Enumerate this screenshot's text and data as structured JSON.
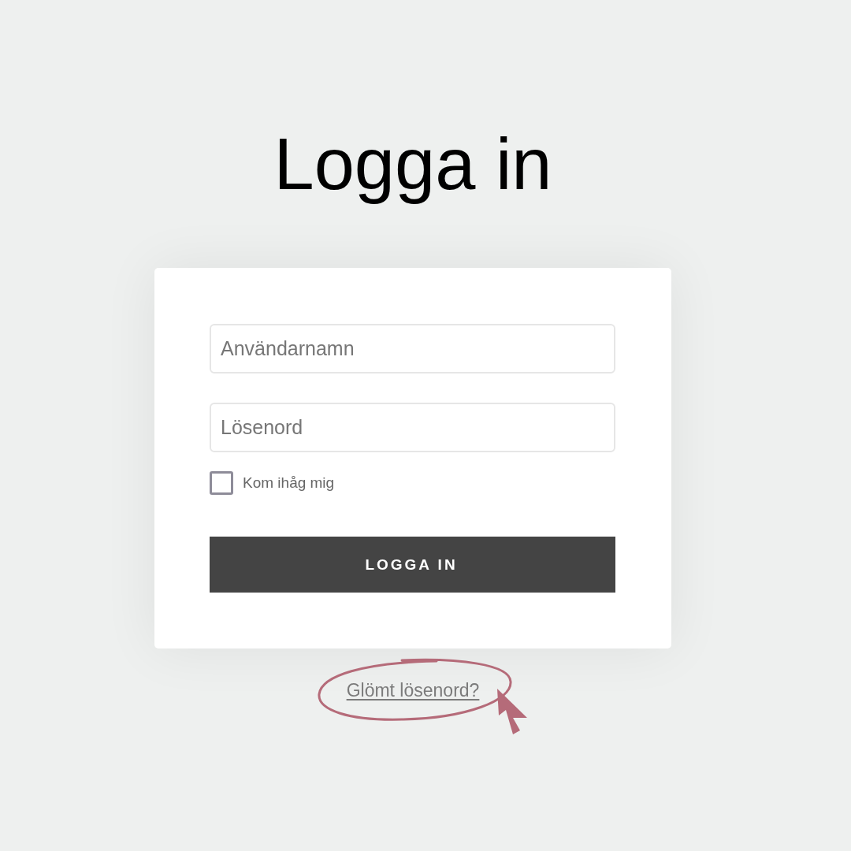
{
  "title": "Logga in",
  "form": {
    "fields": [
      {
        "placeholder": "Användarnamn"
      },
      {
        "placeholder": "Lösenord"
      }
    ],
    "remember": {
      "label": "Kom ihåg mig",
      "checked": false
    },
    "submit": {
      "label": "LOGGA IN"
    }
  },
  "forgot_link": {
    "label": "Glömt lösenord?"
  }
}
